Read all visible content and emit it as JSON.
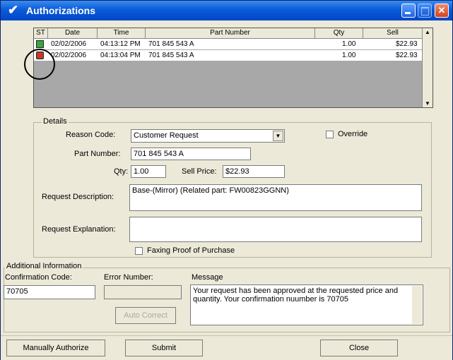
{
  "window": {
    "title": "Authorizations",
    "check_glyph": "✔",
    "close_glyph": "✕"
  },
  "grid": {
    "columns": [
      "ST",
      "Date",
      "Time",
      "Part Number",
      "Qty",
      "Sell"
    ],
    "rows": [
      {
        "status": "approved-icon",
        "date": "02/02/2006",
        "time": "04:13:12 PM",
        "part": "701 845 543 A",
        "qty": "1.00",
        "sell": "$22.93"
      },
      {
        "status": "rejected-icon",
        "date": "02/02/2006",
        "time": "04:13:04 PM",
        "part": "701 845 543 A",
        "qty": "1.00",
        "sell": "$22.93"
      }
    ],
    "scroll_up": "▲",
    "scroll_down": "▼"
  },
  "details": {
    "group_label": "Details",
    "reason_code_label": "Reason Code:",
    "reason_code_value": "Customer Request",
    "override_label": "Override",
    "part_number_label": "Part Number:",
    "part_number_value": "701 845 543 A",
    "qty_label": "Qty:",
    "qty_value": "1.00",
    "sell_price_label": "Sell Price:",
    "sell_price_value": "$22.93",
    "request_description_label": "Request Description:",
    "request_description_value": "Base-(Mirror) (Related part: FW00823GGNN)",
    "request_explanation_label": "Request Explanation:",
    "request_explanation_value": "",
    "faxing_label": "Faxing Proof of Purchase"
  },
  "additional": {
    "group_label": "Additional Information",
    "confirmation_code_label": "Confirmation Code:",
    "confirmation_code_value": "70705",
    "error_number_label": "Error Number:",
    "error_number_value": "",
    "auto_correct_label": "Auto Correct",
    "message_label": "Message",
    "message_value": "Your request has been approved at the requested price and quantity.  Your confirmation nuumber is 70705"
  },
  "buttons": {
    "manually_authorize": "Manually Authorize",
    "submit": "Submit",
    "close": "Close"
  },
  "colors": {
    "title_bar": "#0a5bd8",
    "approved": "#3aa53a",
    "rejected": "#c0392b"
  }
}
